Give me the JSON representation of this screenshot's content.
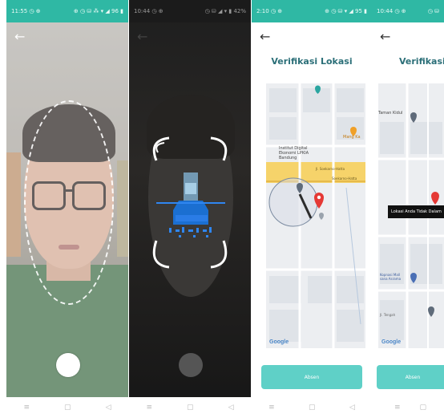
{
  "screens": [
    {
      "status_left": "11:55 ◷ ⊕",
      "status_right": "⊕ ◷ ⛁ ⁂ ▾ ◢ 96 ▮"
    },
    {
      "status_left": "10:44 ◷ ⊕",
      "status_right": "◷ ⛁ ◢ ▾ ▮ 42%"
    },
    {
      "status_left": "2:10 ◷ ⊕",
      "status_right": "⊕ ◷ ⛁ ▾ ◢ 95 ▮"
    },
    {
      "status_left": "10:44 ◷ ⊕",
      "status_right": "◷ ⛁"
    }
  ],
  "icons": {
    "back": "←",
    "nav_menu": "≡",
    "nav_home": "▢",
    "nav_back": "◁"
  },
  "location": {
    "title": "Verifikasi Lokasi",
    "button_label": "Absen",
    "google_logo": "Google",
    "map_labels": {
      "place_institut": "Institut Digital Ekonomi LPKIA Bandung",
      "place_mang": "Mang Ka",
      "road_1": "Jl. Soekarno-Hatta",
      "road_2": "Soekarno-Hatta",
      "place_taman": "Taman Kidul",
      "place_kost": "Kopnasi Mall sana Asrama",
      "place_jln": "Jl. Tengah",
      "tooltip": "Lokasi Anda Tidak Dalam"
    }
  },
  "colors": {
    "accent": "#2fb8a4",
    "button": "#5fd0c7",
    "title": "#2b6f78",
    "pin": "#e53935"
  }
}
